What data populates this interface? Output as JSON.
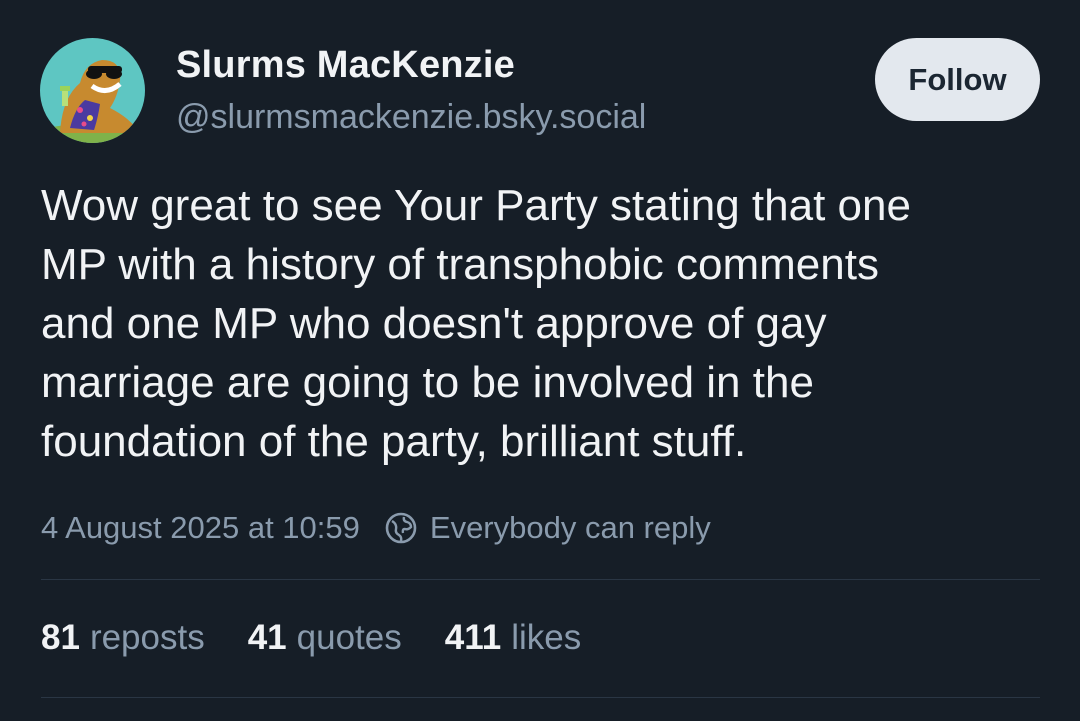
{
  "author": {
    "display_name": "Slurms MacKenzie",
    "handle": "@slurmsmackenzie.bsky.social",
    "avatar_icon": "cartoon-slug-with-sunglasses"
  },
  "follow_button": {
    "label": "Follow"
  },
  "post": {
    "text": "Wow great to see Your Party stating that one\nMP with a history of transphobic comments\nand one MP who doesn't approve of gay\nmarriage are going to be involved in the\nfoundation of the party, brilliant stuff.",
    "timestamp": "4 August 2025 at 10:59",
    "reply_setting": "Everybody can reply",
    "reply_icon": "globe-icon"
  },
  "stats": {
    "reposts": {
      "count": "81",
      "label": "reposts"
    },
    "quotes": {
      "count": "41",
      "label": "quotes"
    },
    "likes": {
      "count": "411",
      "label": "likes"
    }
  },
  "colors": {
    "background": "#161e27",
    "primary_text": "#f1f3f5",
    "secondary_text": "#8a9bad",
    "button_bg": "#e3e8ee",
    "divider": "#2a3644"
  }
}
